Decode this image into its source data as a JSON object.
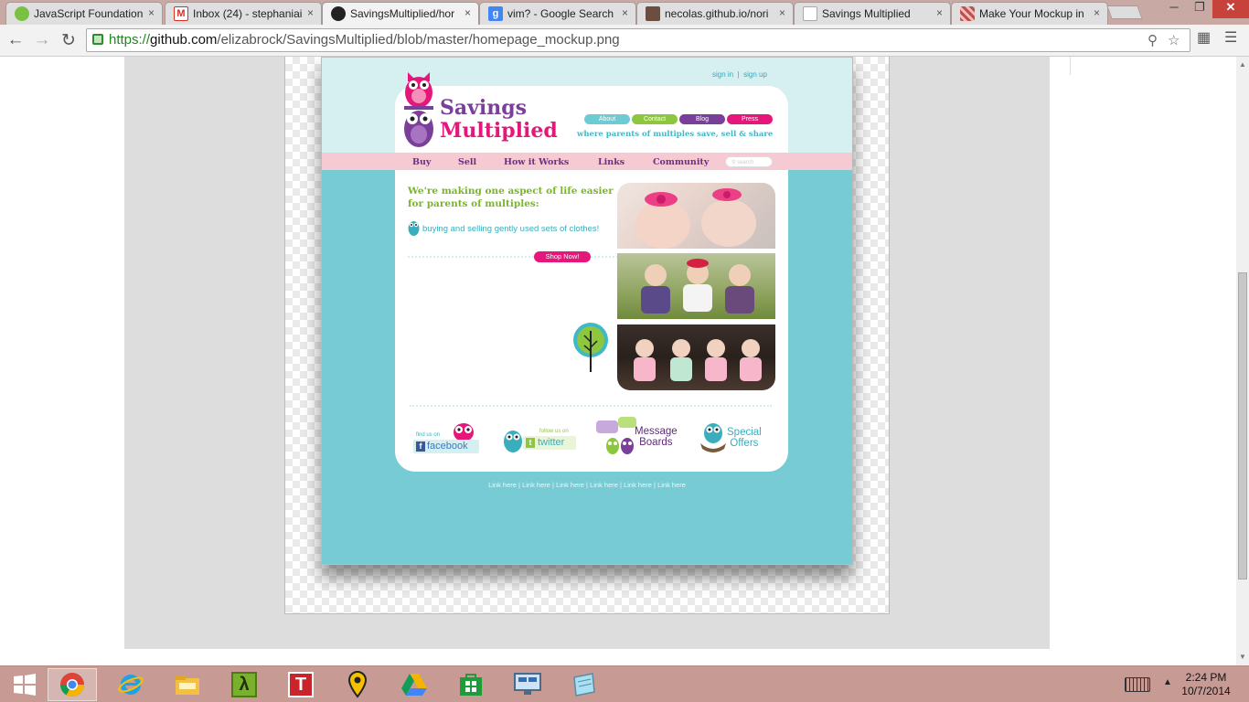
{
  "browser": {
    "tabs": [
      {
        "title": "JavaScript Foundation",
        "favicon_color": "#7ac143"
      },
      {
        "title": "Inbox (24) - stephaniai",
        "favicon_color": "#d93025"
      },
      {
        "title": "SavingsMultiplied/hor",
        "favicon_color": "#222222"
      },
      {
        "title": "vim? - Google Search",
        "favicon_color": "#4285f4"
      },
      {
        "title": "necolas.github.io/nori",
        "favicon_color": "#6d4c41"
      },
      {
        "title": "Savings Multiplied",
        "favicon_color": "#eeeeee"
      },
      {
        "title": "Make Your Mockup in",
        "favicon_color": "#c0504d"
      }
    ],
    "close_glyph": "×",
    "url": {
      "scheme": "https://",
      "host": "github.com",
      "path": "/elizabrock/SavingsMultiplied/blob/master/homepage_mockup.png"
    }
  },
  "mockup": {
    "sign_in": "sign in",
    "separator": "|",
    "sign_up": "sign up",
    "logo": {
      "line1": "Savings",
      "line2": "Multiplied"
    },
    "tagline": "where parents of multiples save, sell & share",
    "top_pills": [
      {
        "label": "About",
        "color": "#6ccbd3"
      },
      {
        "label": "Contact",
        "color": "#8dc63f"
      },
      {
        "label": "Blog",
        "color": "#7a3f98"
      },
      {
        "label": "Press",
        "color": "#e5177a"
      }
    ],
    "nav": [
      "Buy",
      "Sell",
      "How it Works",
      "Links",
      "Community"
    ],
    "search_placeholder": "search",
    "headline": "We're making one aspect of life easier for parents of multiples:",
    "bullet": "buying and selling gently used sets of clothes!",
    "shop_now": "Shop Now!",
    "social": {
      "facebook_small": "find us on",
      "facebook": "facebook",
      "twitter_small": "follow us on",
      "twitter": "twitter",
      "boards_line1": "Message",
      "boards_line2": "Boards",
      "offers_line1": "Special",
      "offers_line2": "Offers"
    },
    "footer_link": "Link here",
    "footer_link_count": 6
  },
  "taskbar": {
    "time": "2:24 PM",
    "date": "10/7/2014",
    "apps": [
      "windows-start",
      "chrome",
      "internet-explorer",
      "file-explorer",
      "lambda-app",
      "t-app",
      "maps-pin",
      "google-drive",
      "store",
      "remote-desktop",
      "notepad"
    ]
  },
  "colors": {
    "teal": "#76cbd4",
    "purple": "#7a3f98",
    "pink": "#e5177a",
    "green": "#8dc63f",
    "taskbar": "#c79a94"
  }
}
